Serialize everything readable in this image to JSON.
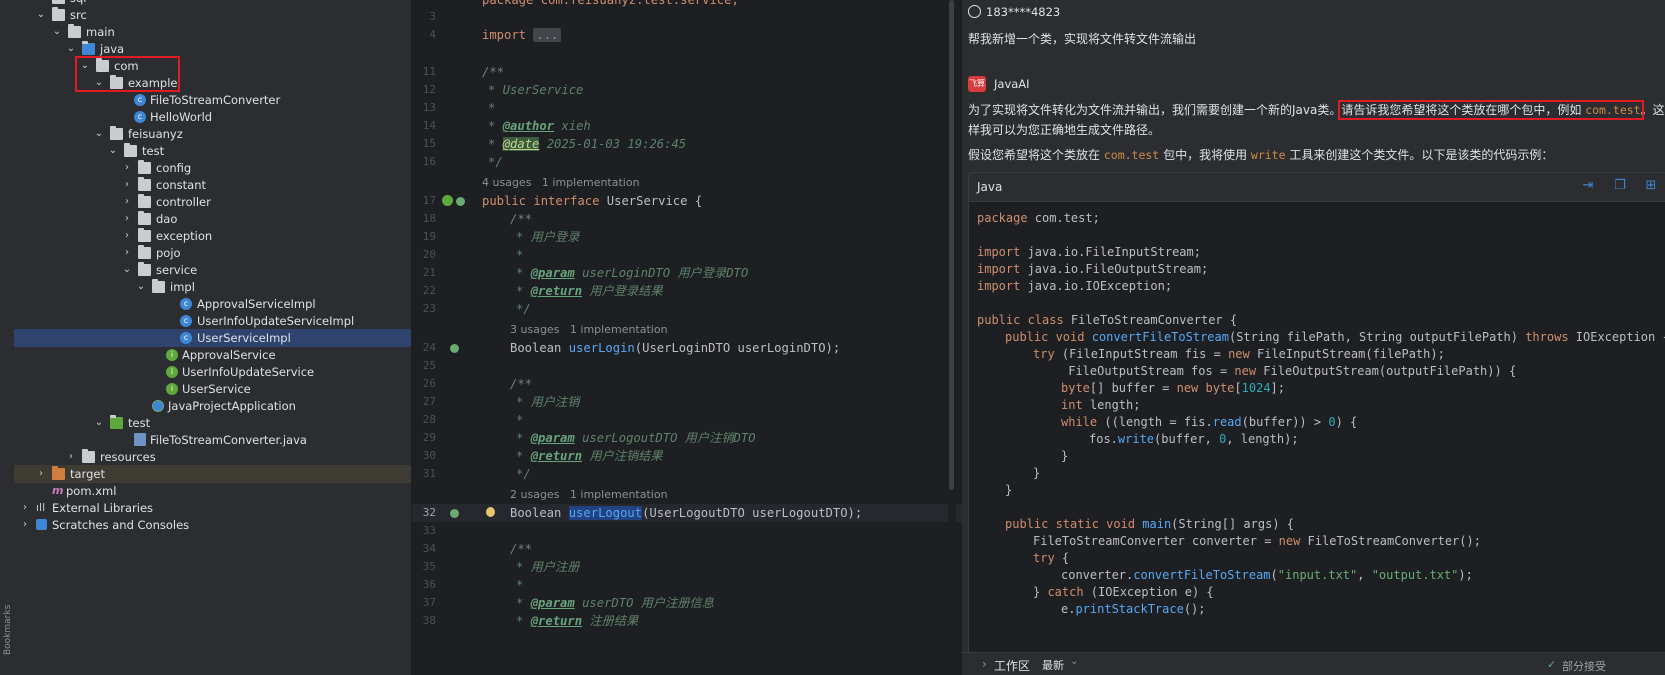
{
  "side_strip": {
    "label": "Bookmarks"
  },
  "tree": {
    "items": [
      {
        "label": "sql"
      },
      {
        "label": "src"
      },
      {
        "label": "main"
      },
      {
        "label": "java"
      },
      {
        "label": "com"
      },
      {
        "label": "example"
      },
      {
        "label": "FileToStreamConverter"
      },
      {
        "label": "HelloWorld"
      },
      {
        "label": "feisuanyz"
      },
      {
        "label": "test"
      },
      {
        "label": "config"
      },
      {
        "label": "constant"
      },
      {
        "label": "controller"
      },
      {
        "label": "dao"
      },
      {
        "label": "exception"
      },
      {
        "label": "pojo"
      },
      {
        "label": "service"
      },
      {
        "label": "impl"
      },
      {
        "label": "ApprovalServiceImpl"
      },
      {
        "label": "UserInfoUpdateServiceImpl"
      },
      {
        "label": "UserServiceImpl"
      },
      {
        "label": "ApprovalService"
      },
      {
        "label": "UserInfoUpdateService"
      },
      {
        "label": "UserService"
      },
      {
        "label": "JavaProjectApplication"
      },
      {
        "label": "test"
      },
      {
        "label": "FileToStreamConverter.java"
      },
      {
        "label": "resources"
      },
      {
        "label": "target"
      },
      {
        "label": "pom.xml"
      },
      {
        "label": "External Libraries"
      },
      {
        "label": "Scratches and Consoles"
      }
    ]
  },
  "editor": {
    "top_code": "package com.feisuanyz.test.service;",
    "line_numbers": [
      "3",
      "4",
      "11",
      "12",
      "13",
      "14",
      "15",
      "16",
      "17",
      "18",
      "19",
      "20",
      "21",
      "22",
      "23",
      "24",
      "25",
      "26",
      "27",
      "28",
      "29",
      "30",
      "31",
      "32",
      "33",
      "34",
      "35",
      "36",
      "37",
      "38"
    ],
    "import_kw": "import",
    "import_fold": "...",
    "doc_open": "/**",
    "doc_close": "*/",
    "doc_star": "*",
    "doc_userservice": "* UserService",
    "author_tag": "@author",
    "author_val": "xieh",
    "date_tag": "@date",
    "date_val": "2025-01-03 19:26:45",
    "hint_top": "4 usages   1 implementation",
    "iface_public": "public",
    "iface_interface": "interface",
    "iface_name": "UserService {",
    "m_doc_open": "/**",
    "login_comment": "* 用户登录",
    "param_tag": "@param",
    "login_param": "userLoginDTO 用户登录DTO",
    "return_tag": "@return",
    "login_return": "用户登录结果",
    "hint_login": "3 usages   1 implementation",
    "login_ret": "Boolean",
    "login_name": "userLogin",
    "login_args": "(UserLoginDTO userLoginDTO);",
    "logout_comment": "* 用户注销",
    "logout_param": "userLogoutDTO 用户注销DTO",
    "logout_return": "用户注销结果",
    "hint_logout": "2 usages   1 implementation",
    "logout_ret": "Boolean",
    "logout_name": "userLogout",
    "logout_args": "(UserLogoutDTO userLogoutDTO);",
    "reg_comment": "* 用户注册",
    "reg_param": "userDTO 用户注册信息",
    "reg_return": "注册结果"
  },
  "chat": {
    "user_name": "183****4823",
    "user_message": "帮我新增一个类，实现将文件转文件流输出",
    "ai_name": "JavaAI",
    "ai_logo": "飞算",
    "ai_p1_a": "为了实现将文件转化为文件流并输出，我们需要创建一个新的Java类。",
    "ai_p1_box": "请告诉我您希望将这个类放在哪个包中，例如",
    "ai_p1_box_code": "com.test",
    "ai_p1_b": "。这",
    "ai_p1_c": "样我可以为您正确地生成文件路径。",
    "ai_p2_a": "假设您希望将这个类放在",
    "ai_p2_code1": "com.test",
    "ai_p2_b": "包中，我将使用",
    "ai_p2_code2": "write",
    "ai_p2_c": "工具来创建这个类文件。以下是该类的代码示例：",
    "code_lang": "Java",
    "footer_workspace": "工作区",
    "footer_latest": "最新",
    "footer_status": "部分接受",
    "code": {
      "l1_kw": "package",
      "l1_rest": " com.test;",
      "l2_kw": "import",
      "l2_rest": " java.io.FileInputStream;",
      "l3_kw": "import",
      "l3_rest": " java.io.FileOutputStream;",
      "l4_kw": "import",
      "l4_rest": " java.io.IOException;",
      "l5_kw": "public class",
      "l5_rest": " FileToStreamConverter {",
      "l6_kw": "public void",
      "l6_fn": " convertFileToStream",
      "l6_rest": "(String filePath, String outputFilePath) ",
      "l6_kw2": "throws",
      "l6_rest2": " IOException {",
      "l7_kw": "try",
      "l7_rest": " (FileInputStream fis = ",
      "l7_kw2": "new",
      "l7_rest2": " FileInputStream(filePath);",
      "l8_rest": " FileOutputStream fos = ",
      "l8_kw": "new",
      "l8_rest2": " FileOutputStream(outputFilePath)) {",
      "l9_kw": "byte",
      "l9_rest": "[] buffer = ",
      "l9_kw2": "new byte",
      "l9_rest2": "[",
      "l9_num": "1024",
      "l9_rest3": "];",
      "l10_kw": "int",
      "l10_rest": " length;",
      "l11_kw": "while",
      "l11_rest": " ((length = fis.",
      "l11_fn": "read",
      "l11_rest2": "(buffer)) > ",
      "l11_num": "0",
      "l11_rest3": ") {",
      "l12_rest": "fos.",
      "l12_fn": "write",
      "l12_rest2": "(buffer, ",
      "l12_num": "0",
      "l12_rest3": ", length);",
      "close": "}",
      "l16_kw": "public static void",
      "l16_fn": " main",
      "l16_rest": "(String[] args) {",
      "l17_rest": "FileToStreamConverter converter = ",
      "l17_kw": "new",
      "l17_rest2": " FileToStreamConverter();",
      "l18_kw": "try",
      "l18_rest": " {",
      "l19_rest": "converter.",
      "l19_fn": "convertFileToStream",
      "l19_rest2": "(",
      "l19_s1": "\"input.txt\"",
      "l19_rest3": ", ",
      "l19_s2": "\"output.txt\"",
      "l19_rest4": ");",
      "l20_rest": "} ",
      "l20_kw": "catch",
      "l20_rest2": " (IOException e) {",
      "l21_rest": "e.",
      "l21_fn": "printStackTrace",
      "l21_rest2": "();"
    }
  },
  "colors": {
    "selection": "#2e436e",
    "annotation_box": "#e01b24",
    "accent": "#3e86d6"
  }
}
